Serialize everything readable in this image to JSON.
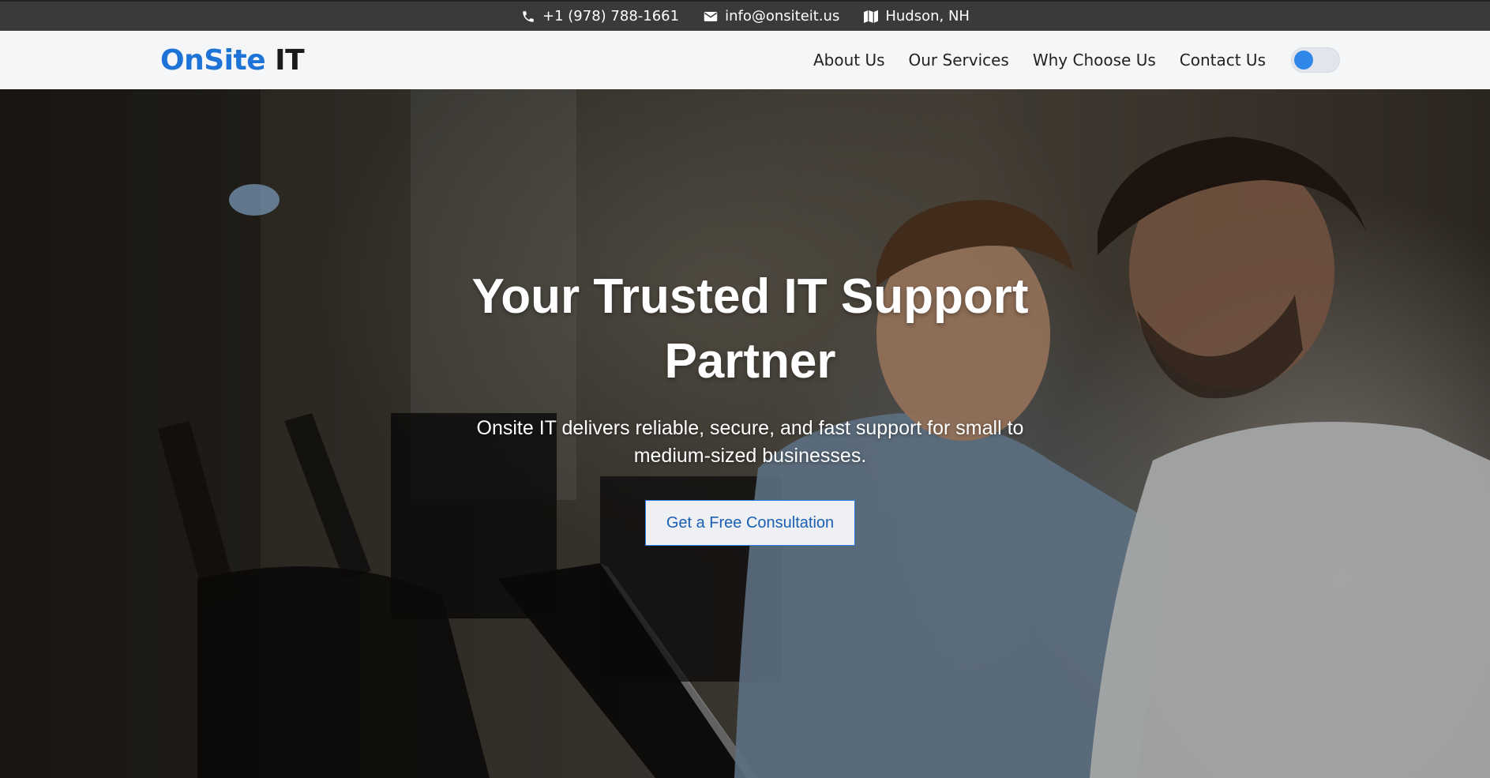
{
  "topbar": {
    "phone": "+1 (978) 788-1661",
    "email": "info@onsiteit.us",
    "location": "Hudson, NH",
    "icons": {
      "phone": "phone-icon",
      "email": "envelope-icon",
      "location": "map-icon"
    }
  },
  "nav": {
    "brand_part1": "OnSite",
    "brand_part2": "IT",
    "items": [
      {
        "label": "About Us"
      },
      {
        "label": "Our Services"
      },
      {
        "label": "Why Choose Us"
      },
      {
        "label": "Contact Us"
      }
    ],
    "theme_toggle": {
      "icon": "theme-toggle",
      "state": "off"
    }
  },
  "hero": {
    "title_line1": "Your Trusted IT Support",
    "title_line2": "Partner",
    "subtitle": "Onsite IT delivers reliable, secure, and fast support for small to medium-sized businesses.",
    "cta_label": "Get a Free Consultation"
  },
  "colors": {
    "brand_blue": "#1e74d6",
    "topbar_bg": "#3a3a3a",
    "nav_bg": "#f5f6f8",
    "cta_text": "#1a5fb4"
  }
}
